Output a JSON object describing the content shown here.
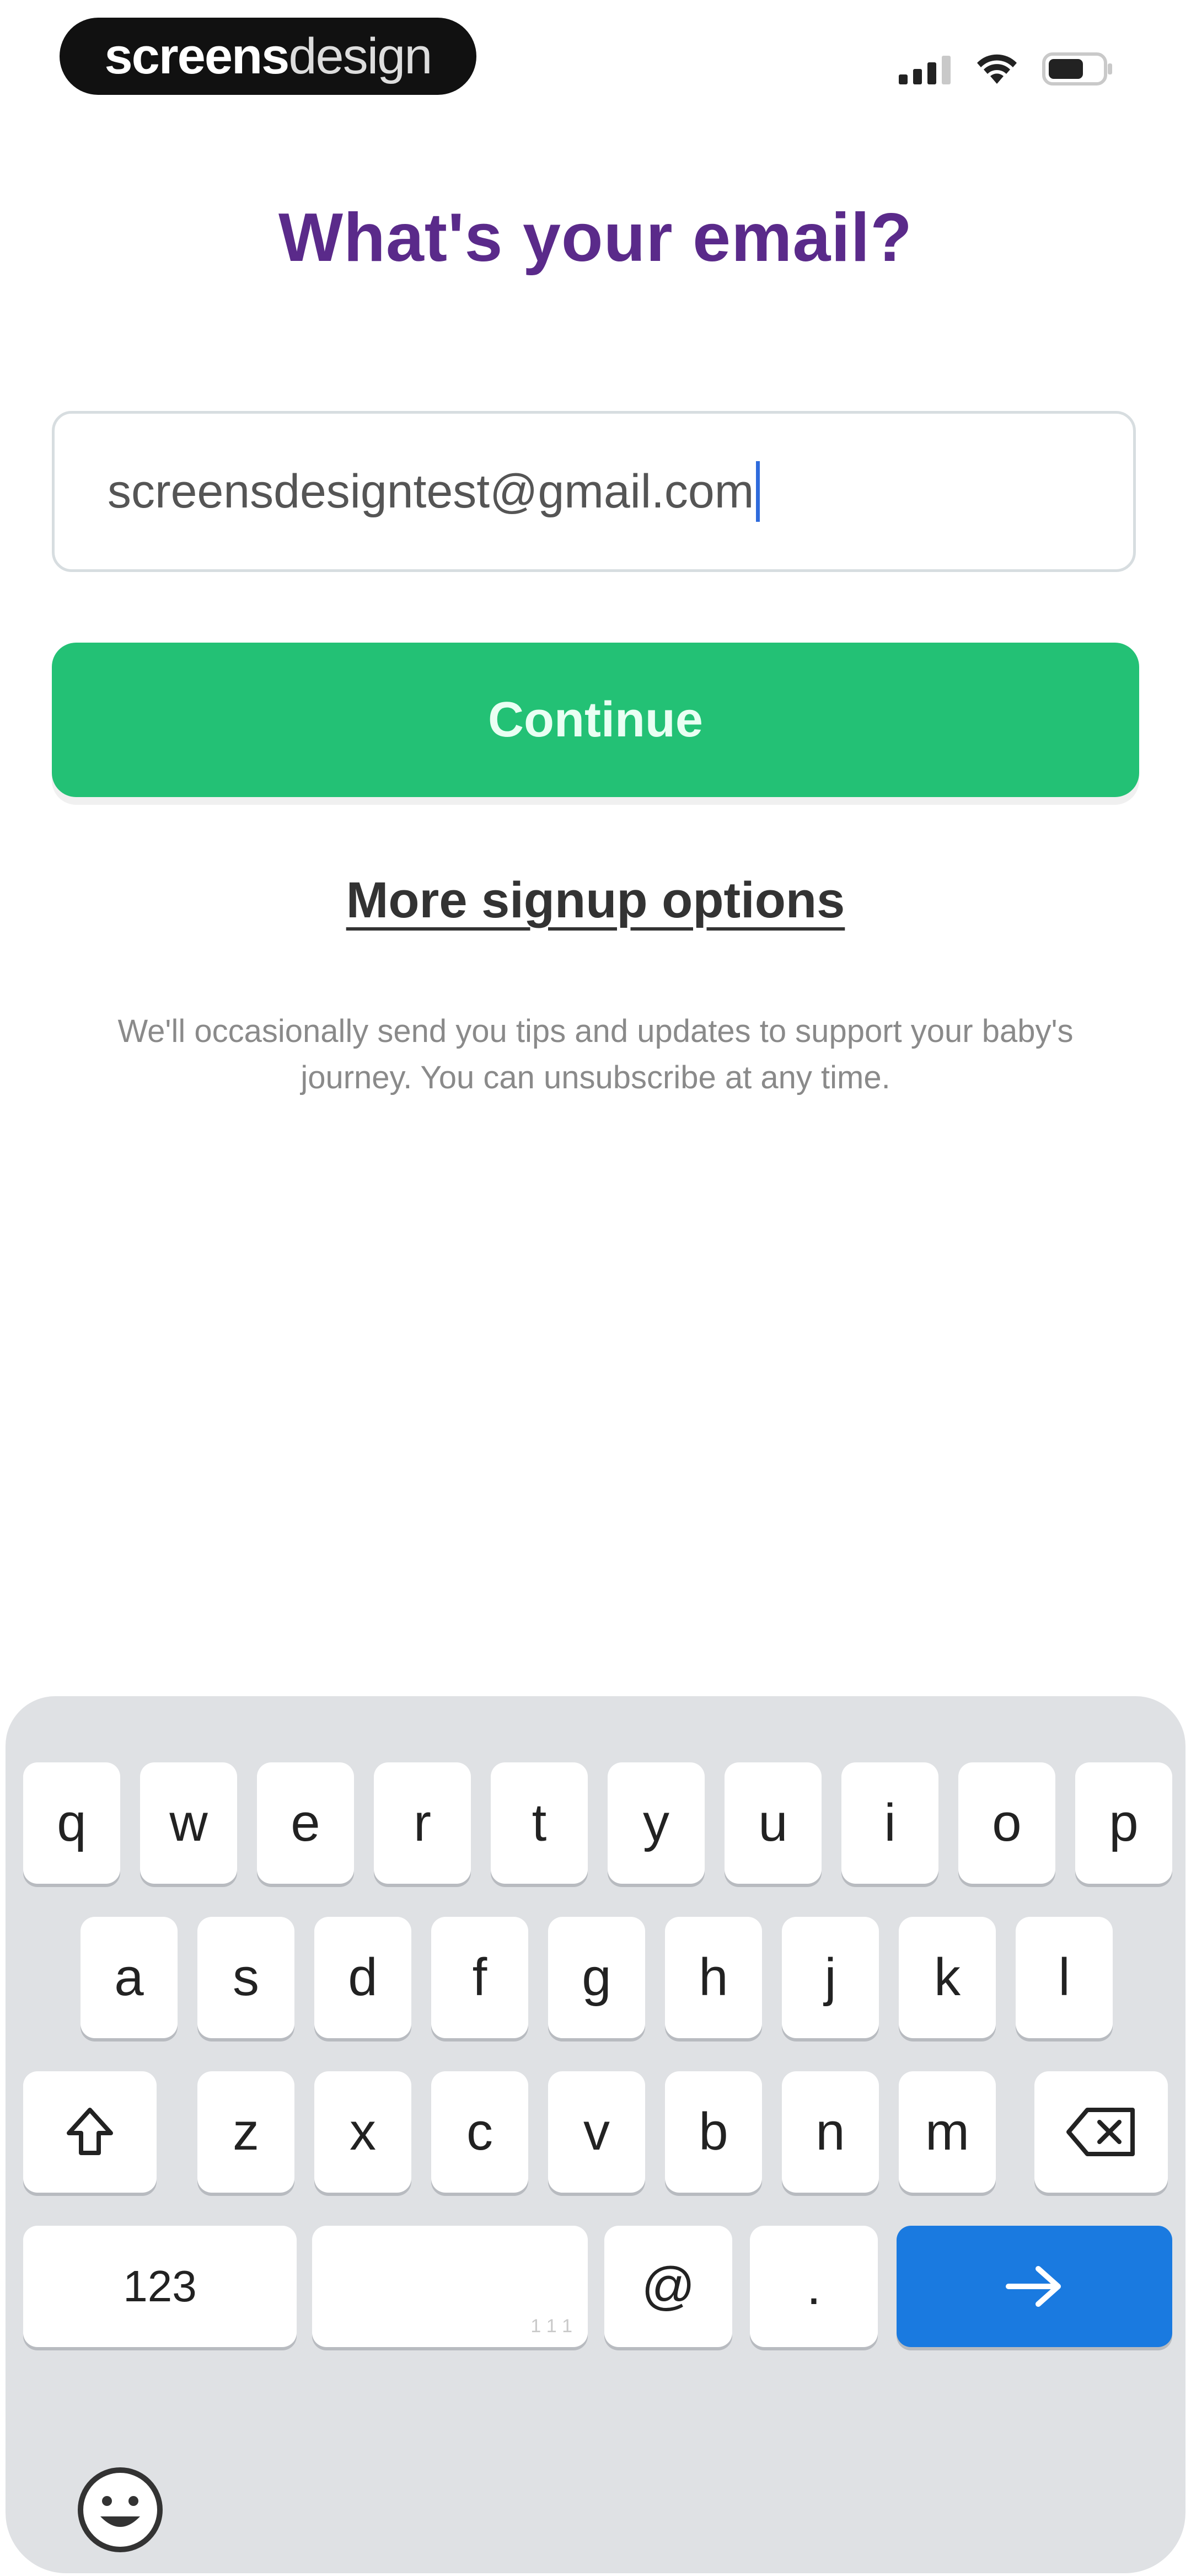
{
  "status_bar": {
    "logo_part1": "screens",
    "logo_part2": "design",
    "icons": [
      "cellular-signal-icon",
      "wifi-icon",
      "battery-icon"
    ]
  },
  "page": {
    "title": "What's your email?",
    "email": {
      "value": "screensdesigntest@gmail.com"
    },
    "continue_label": "Continue",
    "more_options_label": "More signup options",
    "disclaimer": "We'll occasionally send you tips and updates to support your baby's journey. You can unsubscribe at any time."
  },
  "keyboard": {
    "row1": [
      "q",
      "w",
      "e",
      "r",
      "t",
      "y",
      "u",
      "i",
      "o",
      "p"
    ],
    "row2": [
      "a",
      "s",
      "d",
      "f",
      "g",
      "h",
      "j",
      "k",
      "l"
    ],
    "row3": [
      "z",
      "x",
      "c",
      "v",
      "b",
      "n",
      "m"
    ],
    "numbers_label": "123",
    "space_hint": "1 1 1",
    "at_label": "@",
    "dot_label": ".",
    "icons": {
      "shift": "shift-icon",
      "delete": "backspace-icon",
      "return": "arrow-right-icon",
      "emoji": "emoji-icon"
    }
  },
  "colors": {
    "title": "#5a2a8a",
    "button": "#23c175",
    "return_key": "#1a7ae0",
    "keyboard_bg": "#dfe1e4"
  }
}
